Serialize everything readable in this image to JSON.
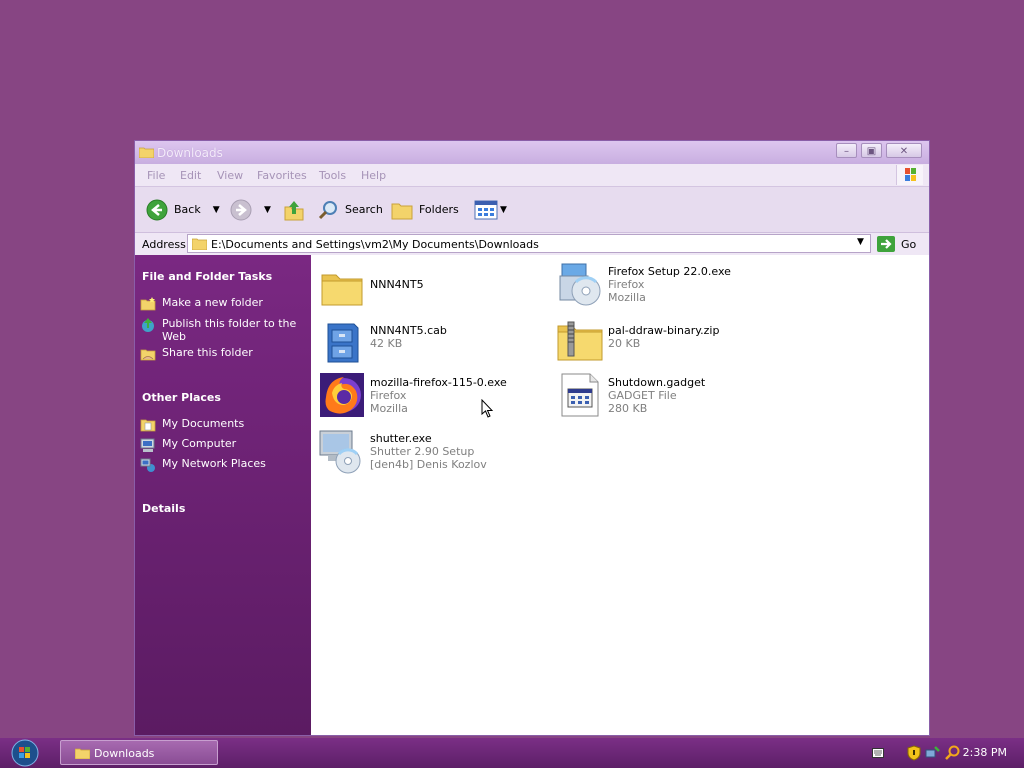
{
  "window": {
    "title": "Downloads",
    "buttons": [
      "minimize",
      "maximize",
      "close"
    ]
  },
  "menu": [
    "File",
    "Edit",
    "View",
    "Favorites",
    "Tools",
    "Help"
  ],
  "toolbar": {
    "back": "Back",
    "search": "Search",
    "folders": "Folders"
  },
  "address": {
    "label": "Address",
    "path": "E:\\Documents and Settings\\vm2\\My Documents\\Downloads",
    "go": "Go"
  },
  "sidebar": {
    "tasks_title": "File and Folder Tasks",
    "tasks": [
      "Make a new folder",
      "Publish this folder to the Web",
      "Share this folder"
    ],
    "places_title": "Other Places",
    "places": [
      "My Documents",
      "My Computer",
      "My Network Places"
    ],
    "details_title": "Details"
  },
  "files": [
    {
      "name": "NNN4NT5",
      "lines": [],
      "icon": "folder-icon"
    },
    {
      "name": "Firefox Setup 22.0.exe",
      "lines": [
        "Firefox",
        "Mozilla"
      ],
      "icon": "installer-cd-icon"
    },
    {
      "name": "NNN4NT5.cab",
      "lines": [
        "42 KB"
      ],
      "icon": "cabinet-icon"
    },
    {
      "name": "pal-ddraw-binary.zip",
      "lines": [
        "20 KB"
      ],
      "icon": "zip-folder-icon"
    },
    {
      "name": "mozilla-firefox-115-0.exe",
      "lines": [
        "Firefox",
        "Mozilla"
      ],
      "icon": "firefox-icon"
    },
    {
      "name": "Shutdown.gadget",
      "lines": [
        "GADGET File",
        "280 KB"
      ],
      "icon": "gadget-file-icon"
    },
    {
      "name": "shutter.exe",
      "lines": [
        "Shutter 2.90 Setup",
        "[den4b] Denis Kozlov"
      ],
      "icon": "setup-cd-icon"
    }
  ],
  "taskbar": {
    "task": "Downloads",
    "clock": "2:38 PM"
  },
  "colors": {
    "desktop": "#874583",
    "sidebar": "#6a2272",
    "taskbar": "#6d2677"
  }
}
